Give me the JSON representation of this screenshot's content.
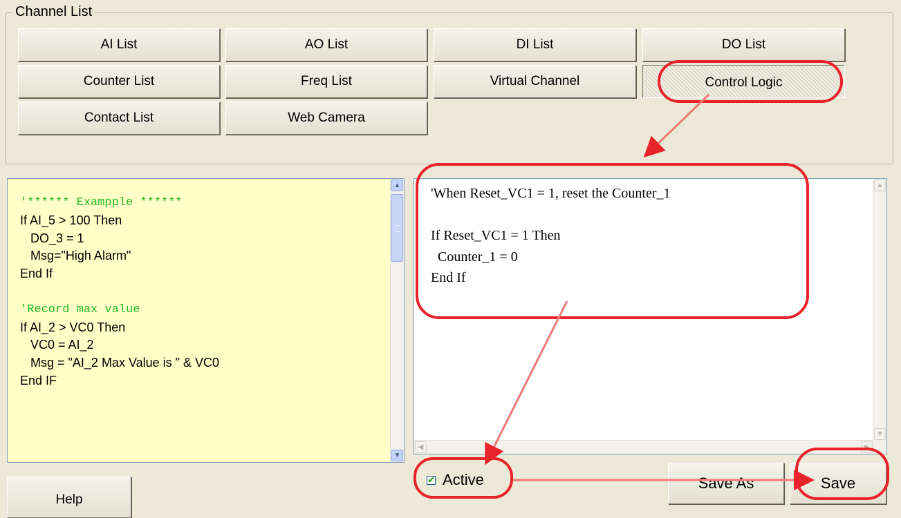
{
  "group": {
    "title": "Channel List"
  },
  "buttons": {
    "ai_list": "AI List",
    "ao_list": "AO List",
    "di_list": "DI List",
    "do_list": "DO List",
    "counter_list": "Counter List",
    "freq_list": "Freq List",
    "virtual_channel": "Virtual Channel",
    "control_logic": "Control Logic",
    "contact_list": "Contact List",
    "web_camera": "Web Camera",
    "help": "Help",
    "save_as": "Save As",
    "save": "Save"
  },
  "example_code": {
    "lines": [
      "'****** Exampple ******",
      "If AI_5 > 100 Then",
      "   DO_3 = 1",
      "   Msg=\"High Alarm\"",
      "End If",
      "",
      "'Record max value",
      "If AI_2 > VC0 Then",
      "   VC0 = AI_2",
      "   Msg = \"AI_2 Max Value is \" & VC0",
      "End IF"
    ]
  },
  "editor": {
    "lines": [
      "'When Reset_VC1 = 1, reset the Counter_1",
      "",
      "If Reset_VC1 = 1 Then",
      "  Counter_1 = 0",
      "End If"
    ]
  },
  "active": {
    "label": "Active",
    "checked": true
  },
  "colors": {
    "annotation": "#e8232a",
    "arrow": "#f07a7a",
    "comment": "#22b822",
    "example_bg": "#ffffc8",
    "window_bg": "#ece9d8"
  }
}
